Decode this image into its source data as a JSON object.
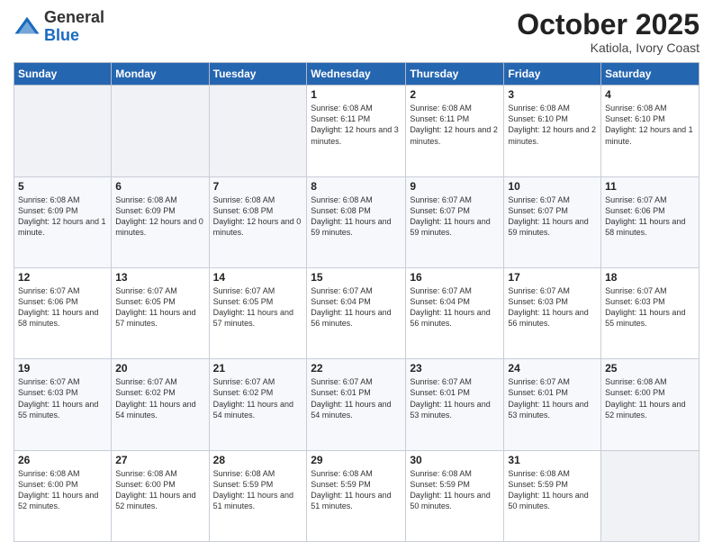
{
  "header": {
    "logo_general": "General",
    "logo_blue": "Blue",
    "title": "October 2025",
    "location": "Katiola, Ivory Coast"
  },
  "days_of_week": [
    "Sunday",
    "Monday",
    "Tuesday",
    "Wednesday",
    "Thursday",
    "Friday",
    "Saturday"
  ],
  "weeks": [
    [
      {
        "day": "",
        "info": "",
        "empty": true
      },
      {
        "day": "",
        "info": "",
        "empty": true
      },
      {
        "day": "",
        "info": "",
        "empty": true
      },
      {
        "day": "1",
        "info": "Sunrise: 6:08 AM\nSunset: 6:11 PM\nDaylight: 12 hours and 3 minutes."
      },
      {
        "day": "2",
        "info": "Sunrise: 6:08 AM\nSunset: 6:11 PM\nDaylight: 12 hours and 2 minutes."
      },
      {
        "day": "3",
        "info": "Sunrise: 6:08 AM\nSunset: 6:10 PM\nDaylight: 12 hours and 2 minutes."
      },
      {
        "day": "4",
        "info": "Sunrise: 6:08 AM\nSunset: 6:10 PM\nDaylight: 12 hours and 1 minute."
      }
    ],
    [
      {
        "day": "5",
        "info": "Sunrise: 6:08 AM\nSunset: 6:09 PM\nDaylight: 12 hours and 1 minute."
      },
      {
        "day": "6",
        "info": "Sunrise: 6:08 AM\nSunset: 6:09 PM\nDaylight: 12 hours and 0 minutes."
      },
      {
        "day": "7",
        "info": "Sunrise: 6:08 AM\nSunset: 6:08 PM\nDaylight: 12 hours and 0 minutes."
      },
      {
        "day": "8",
        "info": "Sunrise: 6:08 AM\nSunset: 6:08 PM\nDaylight: 11 hours and 59 minutes."
      },
      {
        "day": "9",
        "info": "Sunrise: 6:07 AM\nSunset: 6:07 PM\nDaylight: 11 hours and 59 minutes."
      },
      {
        "day": "10",
        "info": "Sunrise: 6:07 AM\nSunset: 6:07 PM\nDaylight: 11 hours and 59 minutes."
      },
      {
        "day": "11",
        "info": "Sunrise: 6:07 AM\nSunset: 6:06 PM\nDaylight: 11 hours and 58 minutes."
      }
    ],
    [
      {
        "day": "12",
        "info": "Sunrise: 6:07 AM\nSunset: 6:06 PM\nDaylight: 11 hours and 58 minutes."
      },
      {
        "day": "13",
        "info": "Sunrise: 6:07 AM\nSunset: 6:05 PM\nDaylight: 11 hours and 57 minutes."
      },
      {
        "day": "14",
        "info": "Sunrise: 6:07 AM\nSunset: 6:05 PM\nDaylight: 11 hours and 57 minutes."
      },
      {
        "day": "15",
        "info": "Sunrise: 6:07 AM\nSunset: 6:04 PM\nDaylight: 11 hours and 56 minutes."
      },
      {
        "day": "16",
        "info": "Sunrise: 6:07 AM\nSunset: 6:04 PM\nDaylight: 11 hours and 56 minutes."
      },
      {
        "day": "17",
        "info": "Sunrise: 6:07 AM\nSunset: 6:03 PM\nDaylight: 11 hours and 56 minutes."
      },
      {
        "day": "18",
        "info": "Sunrise: 6:07 AM\nSunset: 6:03 PM\nDaylight: 11 hours and 55 minutes."
      }
    ],
    [
      {
        "day": "19",
        "info": "Sunrise: 6:07 AM\nSunset: 6:03 PM\nDaylight: 11 hours and 55 minutes."
      },
      {
        "day": "20",
        "info": "Sunrise: 6:07 AM\nSunset: 6:02 PM\nDaylight: 11 hours and 54 minutes."
      },
      {
        "day": "21",
        "info": "Sunrise: 6:07 AM\nSunset: 6:02 PM\nDaylight: 11 hours and 54 minutes."
      },
      {
        "day": "22",
        "info": "Sunrise: 6:07 AM\nSunset: 6:01 PM\nDaylight: 11 hours and 54 minutes."
      },
      {
        "day": "23",
        "info": "Sunrise: 6:07 AM\nSunset: 6:01 PM\nDaylight: 11 hours and 53 minutes."
      },
      {
        "day": "24",
        "info": "Sunrise: 6:07 AM\nSunset: 6:01 PM\nDaylight: 11 hours and 53 minutes."
      },
      {
        "day": "25",
        "info": "Sunrise: 6:08 AM\nSunset: 6:00 PM\nDaylight: 11 hours and 52 minutes."
      }
    ],
    [
      {
        "day": "26",
        "info": "Sunrise: 6:08 AM\nSunset: 6:00 PM\nDaylight: 11 hours and 52 minutes."
      },
      {
        "day": "27",
        "info": "Sunrise: 6:08 AM\nSunset: 6:00 PM\nDaylight: 11 hours and 52 minutes."
      },
      {
        "day": "28",
        "info": "Sunrise: 6:08 AM\nSunset: 5:59 PM\nDaylight: 11 hours and 51 minutes."
      },
      {
        "day": "29",
        "info": "Sunrise: 6:08 AM\nSunset: 5:59 PM\nDaylight: 11 hours and 51 minutes."
      },
      {
        "day": "30",
        "info": "Sunrise: 6:08 AM\nSunset: 5:59 PM\nDaylight: 11 hours and 50 minutes."
      },
      {
        "day": "31",
        "info": "Sunrise: 6:08 AM\nSunset: 5:59 PM\nDaylight: 11 hours and 50 minutes."
      },
      {
        "day": "",
        "info": "",
        "empty": true
      }
    ]
  ]
}
